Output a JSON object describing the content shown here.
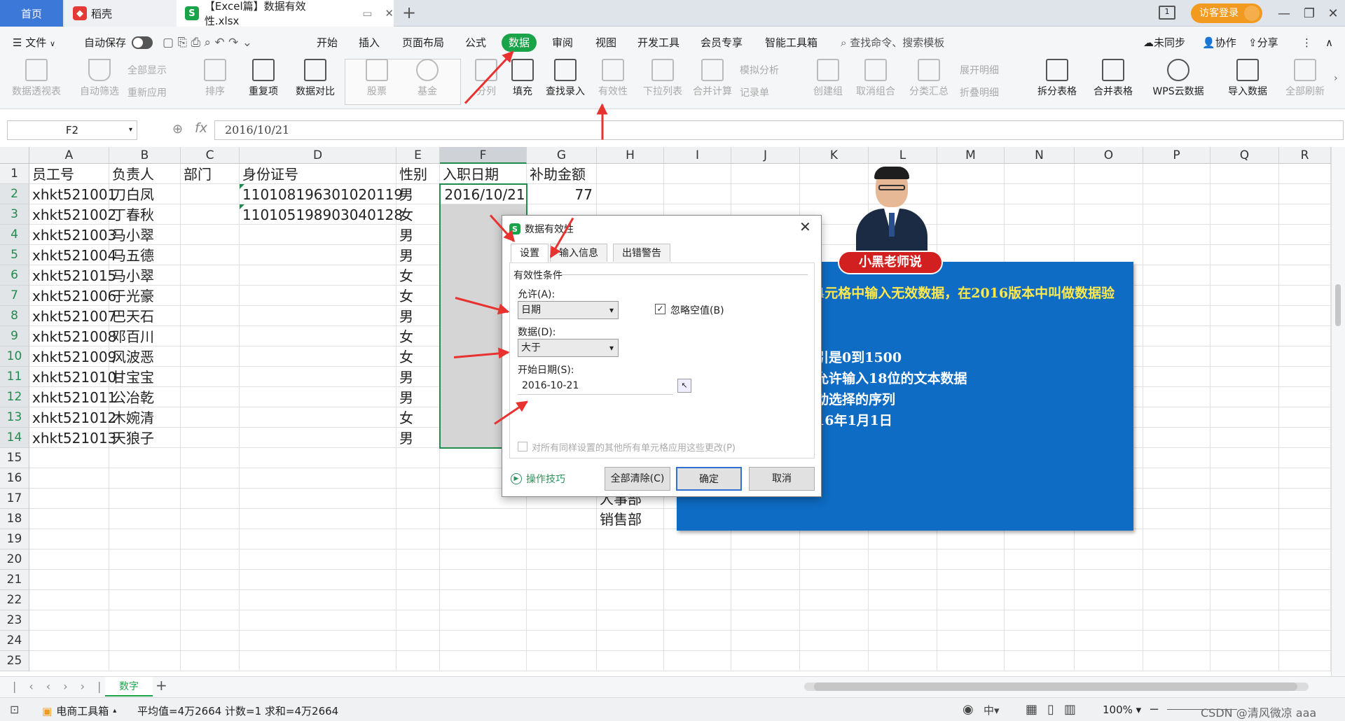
{
  "tabs": {
    "home": "首页",
    "daoke": "稻壳",
    "file": "【Excel篇】数据有效性.xlsx",
    "login": "访客登录"
  },
  "menu": {
    "file": "文件",
    "autosave": "自动保存",
    "items": [
      "开始",
      "插入",
      "页面布局",
      "公式",
      "数据",
      "审阅",
      "视图",
      "开发工具",
      "会员专享",
      "智能工具箱"
    ],
    "search": "查找命令、搜索模板",
    "sync": "未同步",
    "collab": "协作",
    "share": "分享"
  },
  "ribbon": {
    "pivot": "数据透视表",
    "autofilter": "自动筛选",
    "showall": "全部显示",
    "reapply": "重新应用",
    "sort": "排序",
    "dup": "重复项",
    "compare": "数据对比",
    "stock": "股票",
    "fund": "基金",
    "split": "分列",
    "fill": "填充",
    "lookup": "查找录入",
    "validity": "有效性",
    "dropdown": "下拉列表",
    "consolidate": "合并计算",
    "simulate": "模拟分析",
    "record": "记录单",
    "group": "创建组",
    "ungroup": "取消组合",
    "subtotal": "分类汇总",
    "expand": "展开明细",
    "collapse": "折叠明细",
    "splittable": "拆分表格",
    "mergetable": "合并表格",
    "cloud": "WPS云数据",
    "import": "导入数据",
    "refreshall": "全部刷新"
  },
  "formula": {
    "namebox": "F2",
    "fx": "fx",
    "value": "2016/10/21"
  },
  "grid": {
    "columns": [
      "A",
      "B",
      "C",
      "D",
      "E",
      "F",
      "G",
      "H",
      "I",
      "J",
      "K",
      "L",
      "M",
      "N",
      "O",
      "P",
      "Q",
      "R"
    ],
    "rows": [
      "1",
      "2",
      "3",
      "4",
      "5",
      "6",
      "7",
      "8",
      "9",
      "10",
      "11",
      "12",
      "13",
      "14",
      "15",
      "16",
      "17",
      "18",
      "19",
      "20",
      "21",
      "22",
      "23",
      "24",
      "25"
    ],
    "headers": {
      "A": "员工号",
      "B": "负责人",
      "C": "部门",
      "D": "身份证号",
      "E": "性别",
      "F": "入职日期",
      "G": "补助金额"
    },
    "ids": [
      "xhkt521001",
      "xhkt521002",
      "xhkt521003",
      "xhkt521004",
      "xhkt521015",
      "xhkt521006",
      "xhkt521007",
      "xhkt521008",
      "xhkt521009",
      "xhkt521010",
      "xhkt521011",
      "xhkt521012",
      "xhkt521013"
    ],
    "names": [
      "刀白凤",
      "丁春秋",
      "马小翠",
      "马五德",
      "马小翠",
      "于光豪",
      "巴天石",
      "邓百川",
      "风波恶",
      "甘宝宝",
      "公冶乾",
      "木婉清",
      "天狼子"
    ],
    "genders": [
      "男",
      "女",
      "男",
      "男",
      "女",
      "女",
      "男",
      "女",
      "女",
      "男",
      "男",
      "女",
      "男"
    ],
    "idcards": [
      "110108196301020119",
      "110105198903040128"
    ],
    "date_f2": "2016/10/21",
    "amount_g2": "77",
    "dept_h17": "人事部",
    "dept_h18": "销售部"
  },
  "dialog": {
    "title": "数据有效性",
    "tabs": [
      "设置",
      "输入信息",
      "出错警告"
    ],
    "section": "有效性条件",
    "allow_label": "允许(A):",
    "allow_value": "日期",
    "ignore_blank": "忽略空值(B)",
    "data_label": "数据(D):",
    "data_value": "大于",
    "start_label": "开始日期(S):",
    "start_value": "2016-10-21",
    "apply_all": "对所有同样设置的其他所有单元格应用这些更改(P)",
    "tips": "操作技巧",
    "clear": "全部清除(C)",
    "ok": "确定",
    "cancel": "取消"
  },
  "panel": {
    "badge": "小黑老师说",
    "line1": "4元格中输入无效数据，在2016版本中叫做数据验",
    "line2": "引是0到1500",
    "line3": "允许输入18位的文本数据",
    "line4": "动选择的序列",
    "line5": "16年1月1日"
  },
  "sheet": {
    "name": "数字",
    "add": "+"
  },
  "status": {
    "toolbox": "电商工具箱",
    "stats": "平均值=4万2664  计数=1  求和=4万2664",
    "zoom": "100%",
    "watermark": "CSDN @清风微凉 aaa"
  },
  "colors": {
    "accent": "#3c78d8",
    "data_tab": "#1aa44a",
    "panel": "#0e6cc4",
    "arrow": "#e8322f",
    "select": "#1f8b4c"
  }
}
